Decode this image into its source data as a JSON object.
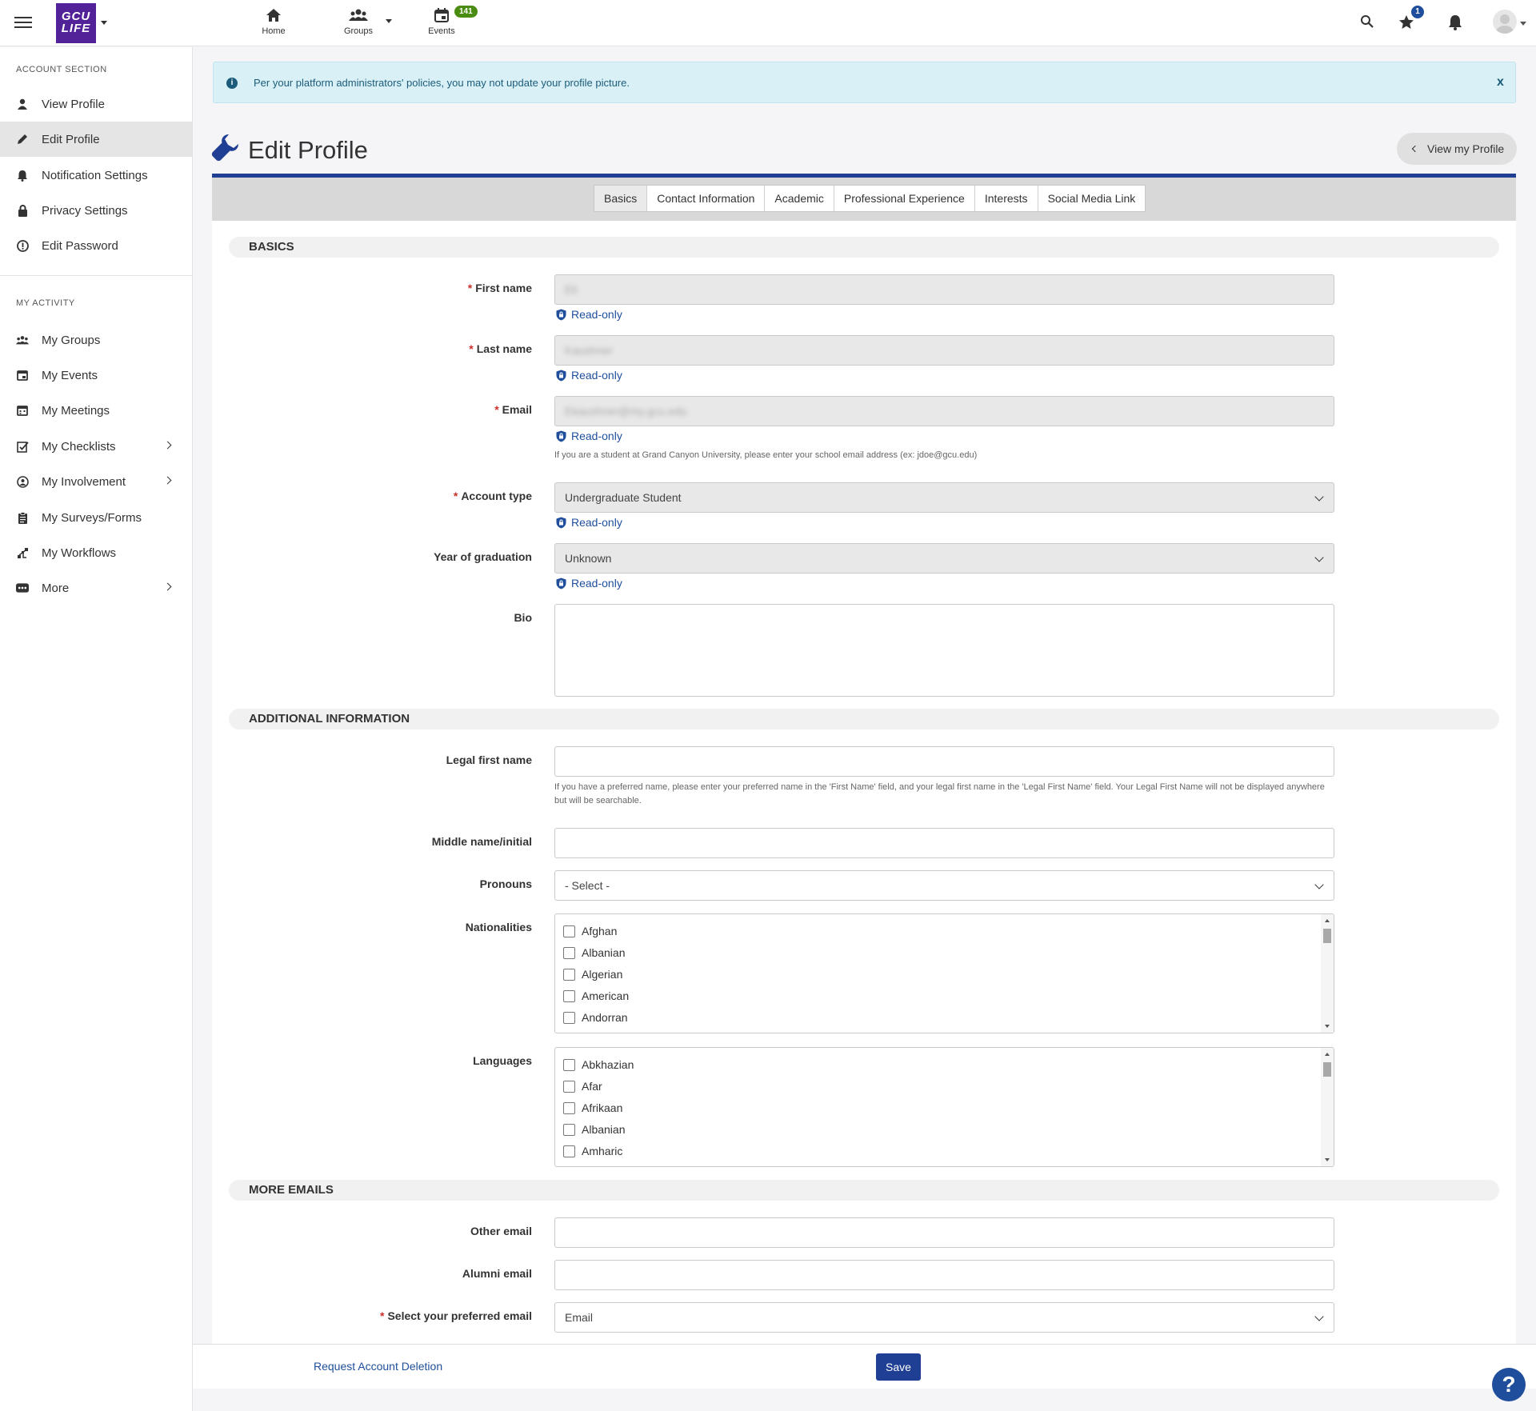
{
  "topbar": {
    "logo_text": "GCU LIFE",
    "nav": [
      {
        "label": "Home",
        "icon": "home-icon"
      },
      {
        "label": "Groups",
        "icon": "groups-icon"
      },
      {
        "label": "Events",
        "icon": "calendar-icon"
      }
    ],
    "events_badge": "141",
    "favorites_badge": "1"
  },
  "sidebar": {
    "account_section_label": "ACCOUNT SECTION",
    "account_items": [
      {
        "label": "View Profile",
        "icon": "person-icon"
      },
      {
        "label": "Edit Profile",
        "icon": "pencil-icon",
        "active": true
      },
      {
        "label": "Notification Settings",
        "icon": "bell-icon"
      },
      {
        "label": "Privacy Settings",
        "icon": "lock-icon"
      },
      {
        "label": "Edit Password",
        "icon": "exclamation-circle-icon"
      }
    ],
    "activity_section_label": "MY ACTIVITY",
    "activity_items": [
      {
        "label": "My Groups",
        "icon": "groups-icon"
      },
      {
        "label": "My Events",
        "icon": "calendar-icon"
      },
      {
        "label": "My Meetings",
        "icon": "calendar-grid-icon"
      },
      {
        "label": "My Checklists",
        "icon": "checklist-icon",
        "has_submenu": true
      },
      {
        "label": "My Involvement",
        "icon": "involvement-icon",
        "has_submenu": true
      },
      {
        "label": "My Surveys/Forms",
        "icon": "clipboard-icon"
      },
      {
        "label": "My Workflows",
        "icon": "workflow-icon"
      },
      {
        "label": "More",
        "icon": "more-icon",
        "has_submenu": true
      }
    ]
  },
  "alert": {
    "text": "Per your platform administrators' policies, you may not update your profile picture.",
    "close_label": "x"
  },
  "header": {
    "title": "Edit Profile",
    "view_profile_label": "View my Profile"
  },
  "tabs": [
    "Basics",
    "Contact Information",
    "Academic",
    "Professional Experience",
    "Interests",
    "Social Media Link"
  ],
  "basics": {
    "heading": "BASICS",
    "first_name_label": "First name",
    "first_name_value": "Eli",
    "last_name_label": "Last name",
    "last_name_value": "Kaushner",
    "email_label": "Email",
    "email_value": "Ekaushner@my.gcu.edu",
    "email_help": "If you are a student at Grand Canyon University, please enter your school email address (ex: jdoe@gcu.edu)",
    "account_type_label": "Account type",
    "account_type_value": "Undergraduate Student",
    "graduation_label": "Year of graduation",
    "graduation_value": "Unknown",
    "bio_label": "Bio",
    "readonly_label": "Read-only"
  },
  "additional": {
    "heading": "ADDITIONAL INFORMATION",
    "legal_first_label": "Legal first name",
    "legal_first_help": "If you have a preferred name, please enter your preferred name in the 'First Name' field, and your legal first name in the 'Legal First Name' field. Your Legal First Name will not be displayed anywhere but will be searchable.",
    "middle_label": "Middle name/initial",
    "pronouns_label": "Pronouns",
    "pronouns_value": "- Select -",
    "nationalities_label": "Nationalities",
    "nationalities": [
      "Afghan",
      "Albanian",
      "Algerian",
      "American",
      "Andorran"
    ],
    "languages_label": "Languages",
    "languages": [
      "Abkhazian",
      "Afar",
      "Afrikaan",
      "Albanian",
      "Amharic"
    ]
  },
  "more_emails": {
    "heading": "MORE EMAILS",
    "other_label": "Other email",
    "alumni_label": "Alumni email",
    "preferred_label": "Select your preferred email",
    "preferred_value": "Email"
  },
  "footer": {
    "delete_label": "Request Account Deletion",
    "save_label": "Save",
    "help_label": "?"
  }
}
